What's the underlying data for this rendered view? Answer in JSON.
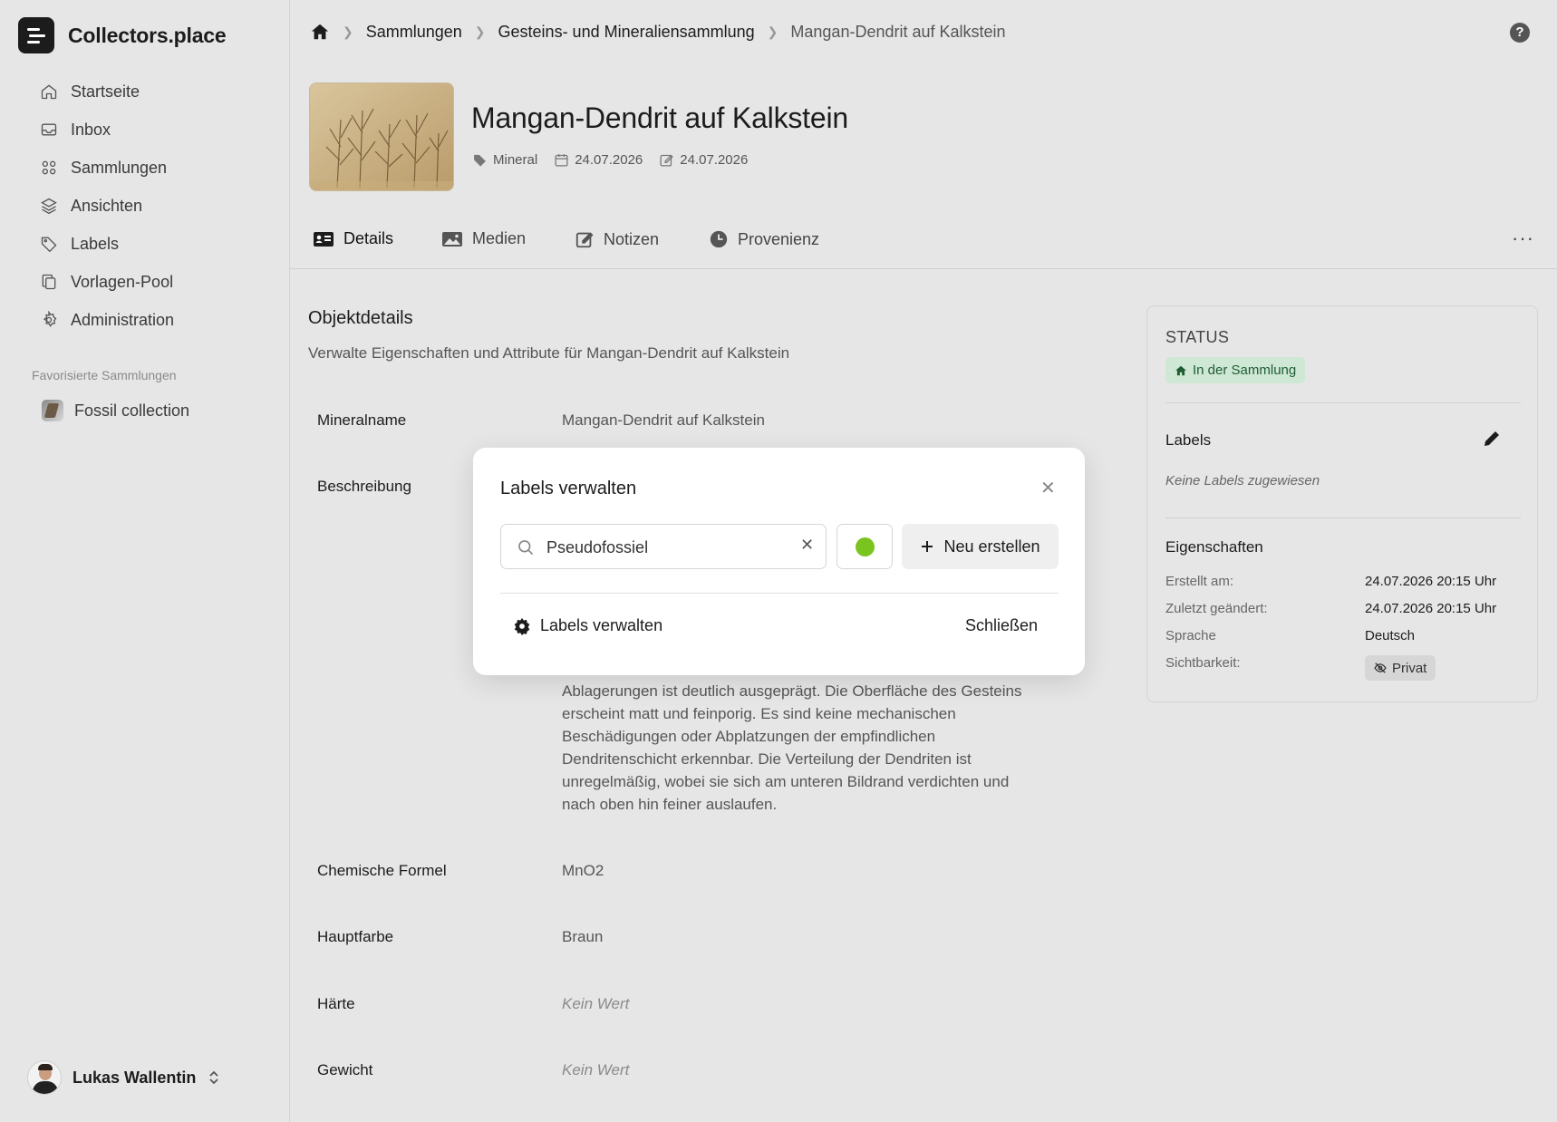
{
  "app": {
    "name": "Collectors.place"
  },
  "sidebar": {
    "items": [
      {
        "label": "Startseite",
        "icon": "home-icon"
      },
      {
        "label": "Inbox",
        "icon": "inbox-icon"
      },
      {
        "label": "Sammlungen",
        "icon": "grid-icon"
      },
      {
        "label": "Ansichten",
        "icon": "layers-icon"
      },
      {
        "label": "Labels",
        "icon": "tag-icon"
      },
      {
        "label": "Vorlagen-Pool",
        "icon": "copy-icon"
      },
      {
        "label": "Administration",
        "icon": "gear-icon"
      }
    ],
    "favorites_heading": "Favorisierte Sammlungen",
    "favorites": [
      {
        "label": "Fossil collection"
      }
    ],
    "user": {
      "name": "Lukas Wallentin"
    }
  },
  "breadcrumb": {
    "items": [
      "Sammlungen",
      "Gesteins- und Mineraliensammlung"
    ],
    "current": "Mangan-Dendrit auf Kalkstein"
  },
  "object": {
    "title": "Mangan-Dendrit auf Kalkstein",
    "type": "Mineral",
    "created_date": "24.07.2026",
    "modified_date": "24.07.2026"
  },
  "tabs": [
    {
      "label": "Details",
      "icon": "id-card-icon",
      "active": true
    },
    {
      "label": "Medien",
      "icon": "image-icon",
      "active": false
    },
    {
      "label": "Notizen",
      "icon": "edit-icon",
      "active": false
    },
    {
      "label": "Provenienz",
      "icon": "clock-icon",
      "active": false
    }
  ],
  "details": {
    "section_title": "Objektdetails",
    "section_subtitle": "Verwalte Eigenschaften und Attribute für Mangan-Dendrit auf Kalkstein",
    "fields": {
      "mineralname": {
        "label": "Mineralname",
        "value": "Mangan-Dendrit auf Kalkstein"
      },
      "beschreibung": {
        "label": "Beschreibung",
        "value": "Ablagerungen ist deutlich ausgeprägt. Die Oberfläche des Gesteins erscheint matt und feinporig. Es sind keine mechanischen Beschädigungen oder Abplatzungen der empfindlichen Dendritenschicht erkennbar. Die Verteilung der Dendriten ist unregelmäßig, wobei sie sich am unteren Bildrand verdichten und nach oben hin feiner auslaufen."
      },
      "formel": {
        "label": "Chemische Formel",
        "value": "MnO2"
      },
      "farbe": {
        "label": "Hauptfarbe",
        "value": "Braun"
      },
      "haerte": {
        "label": "Härte",
        "value": "Kein Wert"
      },
      "gewicht": {
        "label": "Gewicht",
        "value": "Kein Wert"
      }
    }
  },
  "status_panel": {
    "heading": "STATUS",
    "status": "In der Sammlung",
    "labels_heading": "Labels",
    "no_labels": "Keine Labels zugewiesen",
    "properties_heading": "Eigenschaften",
    "properties": {
      "created": {
        "label": "Erstellt am:",
        "value": "24.07.2026 20:15 Uhr"
      },
      "modified": {
        "label": "Zuletzt geändert:",
        "value": "24.07.2026 20:15 Uhr"
      },
      "language": {
        "label": "Sprache",
        "value": "Deutsch"
      },
      "visibility": {
        "label": "Sichtbarkeit:",
        "value": "Privat"
      }
    }
  },
  "modal": {
    "title": "Labels verwalten",
    "search_value": "Pseudofossiel",
    "color": "#7ac41f",
    "new_label": "Neu erstellen",
    "manage_label": "Labels verwalten",
    "close_label": "Schließen"
  }
}
